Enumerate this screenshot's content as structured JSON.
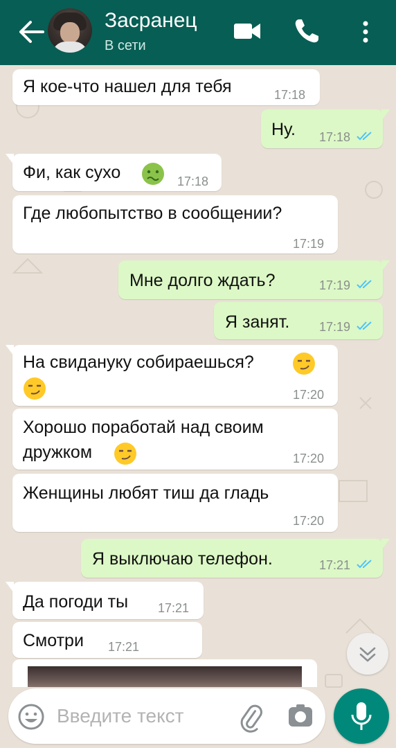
{
  "header": {
    "contact_name": "Засранец",
    "status": "В сети",
    "icons": [
      "back-arrow-icon",
      "video-call-icon",
      "phone-icon",
      "more-vert-icon"
    ]
  },
  "messages": [
    {
      "direction": "in",
      "text": "Я кое-что нашел для тебя",
      "time": "17:18"
    },
    {
      "direction": "out",
      "text": "Ну.",
      "time": "17:18",
      "read": true
    },
    {
      "direction": "in",
      "text": "Фи, как сухо",
      "emoji": "nauseated-face",
      "time": "17:18"
    },
    {
      "direction": "in",
      "text": "Где любопытство в сообщении?",
      "time": "17:19"
    },
    {
      "direction": "out",
      "text": "Мне долго ждать?",
      "time": "17:19",
      "read": true
    },
    {
      "direction": "out",
      "text": "Я занят.",
      "time": "17:19",
      "read": true
    },
    {
      "direction": "in",
      "text": "На свидануку собираешься?",
      "emoji": "smirking-face",
      "emoji2": "smirking-face",
      "time": "17:20"
    },
    {
      "direction": "in",
      "text_line1": "Хорошо поработай над своим",
      "text_line2": "дружком",
      "emoji": "smirking-face",
      "time": "17:20"
    },
    {
      "direction": "in",
      "text": "Женщины любят тиш да гладь",
      "time": "17:20"
    },
    {
      "direction": "out",
      "text": "Я выключаю телефон.",
      "time": "17:21",
      "read": true
    },
    {
      "direction": "in",
      "text": "Да погоди ты",
      "time": "17:21"
    },
    {
      "direction": "in",
      "text": "Смотри",
      "time": "17:21"
    },
    {
      "direction": "in",
      "type": "photo"
    }
  ],
  "composer": {
    "placeholder": "Введите текст",
    "icons": [
      "emoji-icon",
      "attach-icon",
      "camera-icon",
      "mic-icon"
    ]
  },
  "colors": {
    "header": "#075e54",
    "outgoing_bubble": "#dcf8c6",
    "incoming_bubble": "#ffffff",
    "read_ticks": "#4fc3f7",
    "fab": "#00897b",
    "wallpaper": "#e9e1d7"
  }
}
